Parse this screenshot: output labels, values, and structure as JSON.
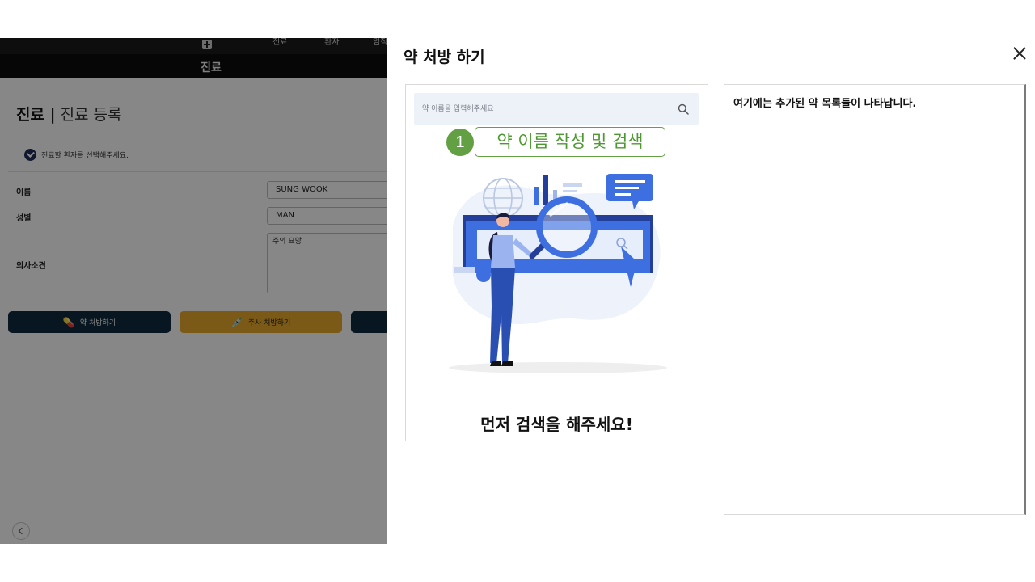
{
  "app": {
    "nav_items": [
      "진료",
      "환자",
      "임직"
    ],
    "bar_title": "진료",
    "page_title": "진료 |",
    "page_subtitle": "진료 등록",
    "step_text": "진료할 환자를 선택해주세요.",
    "form": {
      "name_label": "이름",
      "name_value": "SUNG WOOK",
      "gender_label": "성별",
      "gender_value": "MAN",
      "opinion_label": "의사소견",
      "opinion_value": "주의 요망"
    },
    "buttons": {
      "drug": "약 처방하기",
      "injection": "주사 처방하기"
    }
  },
  "modal": {
    "title": "약 처방 하기",
    "search_placeholder": "약 이름을 입력해주세요",
    "annotation_number": "1",
    "annotation_label": "약 이름 작성 및 검색",
    "empty_message": "먼저 검색을 해주세요!",
    "list_hint": "여기에는 추가된 약 목록들이 나타납니다."
  },
  "colors": {
    "accent_navy": "#0f2a3d",
    "accent_gold": "#e9a92b",
    "annotation_green": "#62a043",
    "illustration_blue": "#3d6fe0"
  },
  "icons": [
    "plus-icon",
    "check-icon",
    "pill-icon",
    "syringe-icon",
    "chevron-left-icon",
    "close-icon",
    "search-icon"
  ]
}
